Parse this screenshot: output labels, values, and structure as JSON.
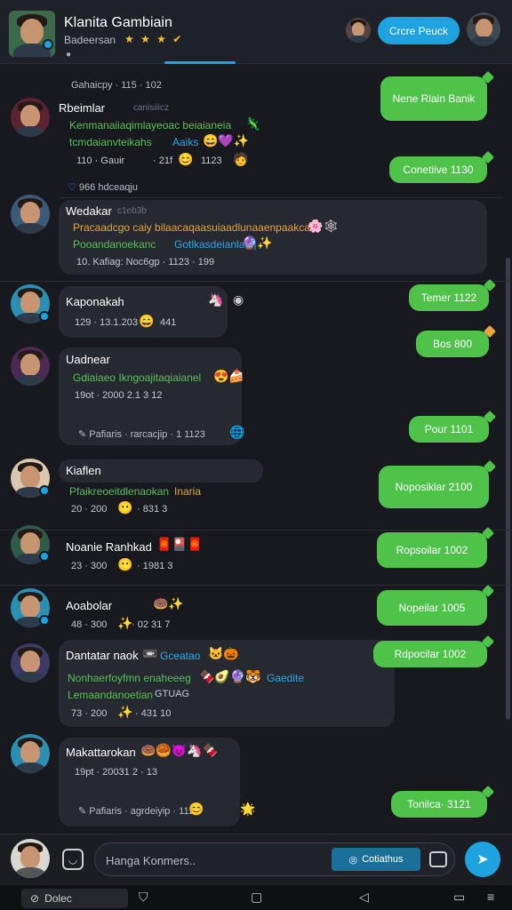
{
  "header": {
    "title": "Klanita Gambiain",
    "subtitle": "Badeersan",
    "stars": "★ ★ ★ ✔",
    "dot": "●",
    "action_label": "Crcre Peuck"
  },
  "messages": [
    {
      "id": "m1",
      "top_meta": "Gahaicpy · 115 · 102",
      "sender": "Rbeimlar",
      "sender_meta": "canisiiicz",
      "line1": "Kenmanaiiaqimlayeoac beiaianeia",
      "line2": "tcmdaianvteikahs",
      "line2_extra": "Aaiks",
      "meta": "110 · Gauir",
      "meta2": "· 21f",
      "meta3": "1123",
      "footer": "966 hdceaqju"
    },
    {
      "id": "m2",
      "sender": "Wedakar",
      "sender_meta": "c1eb3b",
      "line1": "Pracaadcgo caiy bilaacaqaasuiaadlunaaenpaakcan",
      "line2": "Pooandanoekanc",
      "line2_extra": "Gotlkasdeianlae |",
      "meta": "10. Kafiag: Noc6gp · 1123 · 199"
    },
    {
      "id": "m3",
      "sender": "Kaponakah",
      "meta": "129 · 13.1.203",
      "meta2": "441"
    },
    {
      "id": "m4",
      "sender": "Uadnear",
      "line1": "Gdiaiaeo Ikngoajitaqiaianel",
      "meta": "19ot · 2000 2.1 3 12",
      "footer": "Pafiaris · rarcacjip · 1 1123"
    },
    {
      "id": "m5",
      "sender": "Kiaflen",
      "line1": "Pfaikreoeitdlenaokan",
      "line1_extra": "Inaria",
      "meta": "20 · 200",
      "meta2": "· 831 3"
    },
    {
      "id": "m6",
      "sender": "Noanie Ranhkad",
      "meta": "23 · 300",
      "meta2": "· 1981 3"
    },
    {
      "id": "m7",
      "sender": "Aoabolar",
      "meta": "48 · 300",
      "meta2": "· 02 31 7"
    },
    {
      "id": "m8",
      "sender": "Dantatar naok",
      "sender_extra": "Gceatao",
      "line1": "Nonhaerfoyfmn enaheeeg",
      "line1_extra": "Gaedite",
      "line2": "Lemaandanoetian",
      "line2_extra": "GTUAG",
      "meta": "73 · 200",
      "meta2": "· 431 10"
    },
    {
      "id": "m9",
      "sender": "Makattarokan",
      "meta": "19pt · 20031 2 · 13",
      "footer": "Pafiaris · agrdeiyip · 1123"
    }
  ],
  "outgoing": [
    {
      "id": "o1",
      "text": "Nene Rlain Banik"
    },
    {
      "id": "o2",
      "text": "Conetiive 1130"
    },
    {
      "id": "o3",
      "text": "Temer 1122"
    },
    {
      "id": "o4",
      "text": "Bos 800"
    },
    {
      "id": "o5",
      "text": "Pour 1101"
    },
    {
      "id": "o6",
      "text": "Noposiklar 2100"
    },
    {
      "id": "o7",
      "text": "Ropsoilar 1002"
    },
    {
      "id": "o8",
      "text": "Nopeilar 1005"
    },
    {
      "id": "o9",
      "text": "Rdpocilar 1002"
    },
    {
      "id": "o10",
      "text": "Tonilca· 3121"
    }
  ],
  "composer": {
    "placeholder": "Hanga Konmers..",
    "chip_label": "Cotiathus"
  },
  "navbar": {
    "home_label": "Dolec"
  },
  "colors": {
    "accent": "#1fa3e0",
    "outgoing": "#4fc24a",
    "incoming": "#262930",
    "background": "#17191e"
  }
}
